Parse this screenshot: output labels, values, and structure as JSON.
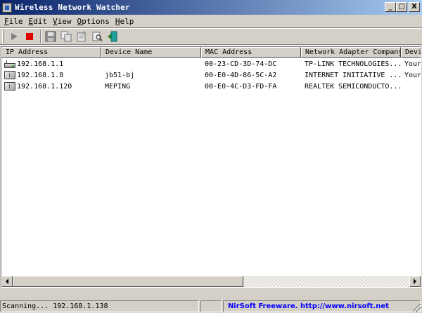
{
  "window": {
    "title": "Wireless Network Watcher",
    "minimize": "_",
    "maximize": "□",
    "close": "X"
  },
  "menu": [
    {
      "label": "File",
      "key": "F",
      "rest": "ile"
    },
    {
      "label": "Edit",
      "key": "E",
      "rest": "dit"
    },
    {
      "label": "View",
      "key": "V",
      "rest": "iew"
    },
    {
      "label": "Options",
      "key": "O",
      "rest": "ptions"
    },
    {
      "label": "Help",
      "key": "H",
      "rest": "elp"
    }
  ],
  "toolbar": {
    "icons": [
      "play-icon",
      "stop-icon",
      "save-icon",
      "copy-icon",
      "properties-icon",
      "find-icon",
      "exit-icon"
    ]
  },
  "columns": [
    "IP Address",
    "Device Name",
    "MAC Address",
    "Network Adapter Company",
    "Devi"
  ],
  "rows": [
    {
      "icon": "router-icon",
      "ip": "192.168.1.1",
      "device": "",
      "mac": "00-23-CD-3D-74-DC",
      "company": "TP-LINK TECHNOLOGIES...",
      "info": "Your"
    },
    {
      "icon": "computer-icon",
      "ip": "192.168.1.8",
      "device": "jb51-bj",
      "mac": "00-E0-4D-86-5C-A2",
      "company": "INTERNET INITIATIVE ...",
      "info": "Your"
    },
    {
      "icon": "computer-icon",
      "ip": "192.168.1.120",
      "device": "MEPING",
      "mac": "00-E0-4C-D3-FD-FA",
      "company": "REALTEK SEMICONDUCTO...",
      "info": ""
    }
  ],
  "status": {
    "scanning": "Scanning... 192.168.1.138",
    "empty": "",
    "freeware": "NirSoft Freeware.  http://www.nirsoft.net"
  },
  "colors": {
    "title_start": "#0a246a",
    "title_end": "#a6caf0",
    "link": "#0000ff",
    "play": "#808080",
    "stop": "#e00000"
  }
}
